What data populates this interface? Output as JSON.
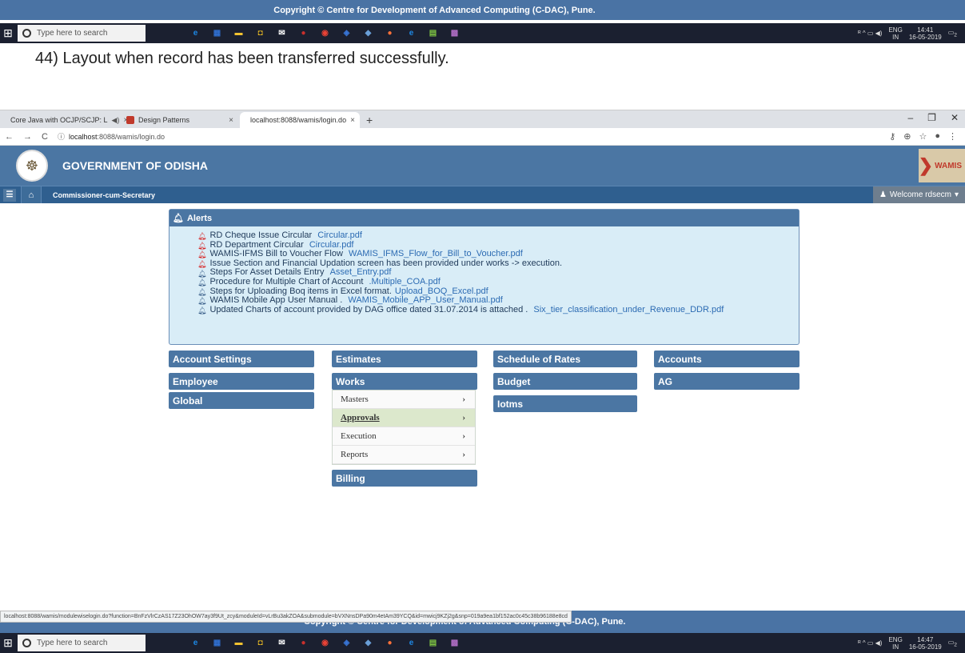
{
  "top_copyright": "Copyright © Centre for Development of Advanced Computing (C-DAC), Pune.",
  "taskbar": {
    "search_placeholder": "Type here to search",
    "tray_lang": "ENG",
    "tray_region": "IN",
    "top_time": "14:41",
    "top_date": "16-05-2019",
    "bottom_time": "14:47",
    "bottom_date": "16-05-2019",
    "notif_count": "2",
    "apps": [
      {
        "name": "ie-icon",
        "color": "#1e88e5",
        "glyph": "e"
      },
      {
        "name": "store-icon",
        "color": "#2f6fd0",
        "glyph": "▦"
      },
      {
        "name": "folder-icon",
        "color": "#f2c230",
        "glyph": "▬"
      },
      {
        "name": "bag-icon",
        "color": "#e8b923",
        "glyph": "◘"
      },
      {
        "name": "mail-icon",
        "color": "#ffffff",
        "glyph": "✉"
      },
      {
        "name": "shield-icon",
        "color": "#c9302c",
        "glyph": "●"
      },
      {
        "name": "chrome-icon",
        "color": "#e94235",
        "glyph": "◉"
      },
      {
        "name": "network-icon",
        "color": "#3875d7",
        "glyph": "◈"
      },
      {
        "name": "box-icon",
        "color": "#6a9fd8",
        "glyph": "◆"
      },
      {
        "name": "firefox-icon",
        "color": "#ff7139",
        "glyph": "●"
      },
      {
        "name": "edge-icon",
        "color": "#1e88e5",
        "glyph": "e"
      },
      {
        "name": "notes-icon",
        "color": "#7dc242",
        "glyph": "▤"
      },
      {
        "name": "misc-icon",
        "color": "#b06ec5",
        "glyph": "▩"
      }
    ]
  },
  "caption": "44) Layout when record has been transferred successfully.",
  "browser": {
    "tabs": [
      {
        "label": "Core Java with OCJP/SCJP: L",
        "fav": "#e53935",
        "audio": "◀)"
      },
      {
        "label": "Design Patterns",
        "fav": "#c0392b"
      },
      {
        "label": "localhost:8088/wamis/login.do",
        "fav": "#666666"
      }
    ],
    "new_tab": "+",
    "url_host": "localhost",
    "url_rest": ":8088/wamis/login.do"
  },
  "header": {
    "title": "GOVERNMENT OF ODISHA",
    "logo_text": "WAMIS"
  },
  "nav": {
    "role": "Commissioner-cum-Secretary",
    "welcome": "Welcome rdsecm"
  },
  "alerts": {
    "title": "Alerts",
    "items": [
      {
        "text": "RD Cheque Issue Circular ",
        "link": "Circular.pdf",
        "bell": "red"
      },
      {
        "text": "RD Department Circular ",
        "link": "Circular.pdf",
        "bell": "red"
      },
      {
        "text": "WAMIS-IFMS Bill to Voucher Flow ",
        "link": "WAMIS_IFMS_Flow_for_Bill_to_Voucher.pdf",
        "bell": "red"
      },
      {
        "text": "Issue Section and Financial Updation screen has been provided under works -> execution.",
        "link": "",
        "bell": "red"
      },
      {
        "text": "Steps For Asset Details Entry ",
        "link": "Asset_Entry.pdf",
        "bell": "blue"
      },
      {
        "text": "Procedure for Multiple Chart of Account ",
        "link": ".Multiple_COA.pdf",
        "bell": "blue"
      },
      {
        "text": "Steps for Uploading Boq items in Excel format.",
        "link": "Upload_BOQ_Excel.pdf",
        "bell": "blue"
      },
      {
        "text": "WAMIS Mobile App User Manual . ",
        "link": "WAMIS_Mobile_APP_User_Manual.pdf",
        "bell": "blue"
      },
      {
        "text": "Updated Charts of account provided by DAG office dated 31.07.2014 is attached . ",
        "link": "Six_tier_classification_under_Revenue_DDR.pdf",
        "bell": "blue"
      }
    ]
  },
  "modules": {
    "account_settings": "Account Settings",
    "employee": "Employee",
    "global": "Global",
    "estimates": "Estimates",
    "works": "Works",
    "billing": "Billing",
    "schedule_of_rates": "Schedule of Rates",
    "budget": "Budget",
    "iotms": "Iotms",
    "accounts": "Accounts",
    "ag": "AG"
  },
  "works_menu": [
    "Masters",
    "Approvals",
    "Execution",
    "Reports"
  ],
  "status_url": "localhost:8088/wamis/modulewiselogin.do?function=BnFzVlrCzAS17Z23OhOW7ay3f9Ut_zcy&moduleId=vLrBu3akZOA&submodule=bVXNnsDPa90m4etAm39YCQ&id=mwicj9KZj2g&snp=019a9ea1bf152ac0c45c38b96188e8cd",
  "bottom_copyright": "Copyright © Centre for Development of Advanced Computing (C-DAC), Pune."
}
